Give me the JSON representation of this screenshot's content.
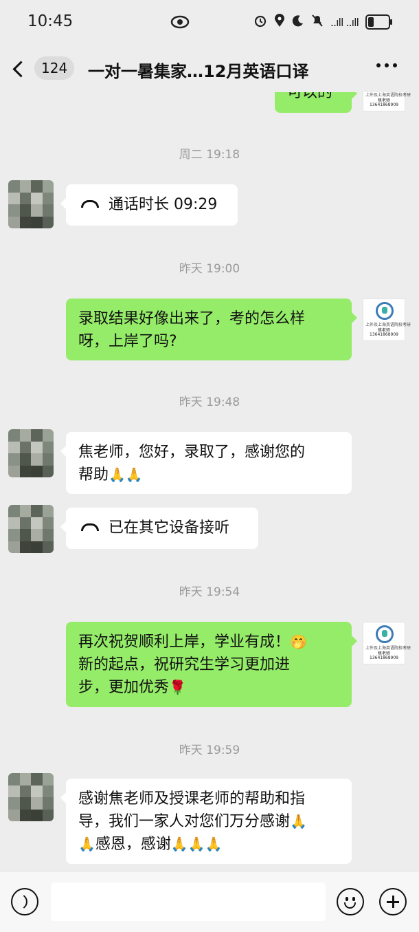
{
  "status_bar": {
    "time": "10:45",
    "signal": "..ıll ..ıll"
  },
  "header": {
    "back_count": "124",
    "title": "一对一暑集家…12月英语口译"
  },
  "messages": [
    {
      "type": "partial_right",
      "text": "可以的"
    },
    {
      "type": "timestamp",
      "text": "周二 19:18"
    },
    {
      "type": "left_call",
      "text": "通话时长 09:29"
    },
    {
      "type": "timestamp",
      "text": "昨天 19:00"
    },
    {
      "type": "right",
      "text_line1": "录取结果好像出来了，考的怎么样",
      "text_line2": "呀，上岸了吗?"
    },
    {
      "type": "timestamp",
      "text": "昨天 19:48"
    },
    {
      "type": "left",
      "text_line1": "焦老师，您好，录取了，感谢您的",
      "text_line2": "帮助",
      "emoji": "🙏🙏"
    },
    {
      "type": "left_call",
      "text": "已在其它设备接听"
    },
    {
      "type": "timestamp",
      "text": "昨天 19:54"
    },
    {
      "type": "right",
      "text_line1": "再次祝贺顺利上岸，学业有成！",
      "emoji1": "🤭",
      "text_line2": "新的起点，祝研究生学习更加进",
      "text_line3": "步，更加优秀",
      "emoji2": "🌹"
    },
    {
      "type": "timestamp",
      "text": "昨天 19:59"
    },
    {
      "type": "left",
      "text_line1": "感谢焦老师及授课老师的帮助和指",
      "text_line2": "导，我们一家人对您们万分感谢",
      "emoji_a": "🙏",
      "text_line3_pre": "🙏",
      "text_line3": "感恩，感谢",
      "emoji_b": "🙏🙏🙏"
    }
  ],
  "teacher_avatar": {
    "line1": "上外及上海英语院校考研",
    "line2": "焦老师",
    "line3": "13641868909"
  },
  "input_bar": {
    "placeholder": ""
  },
  "colors": {
    "background": "#ededed",
    "right_bubble": "#95ec69",
    "left_bubble": "#ffffff",
    "timestamp": "#9a9a9a"
  }
}
